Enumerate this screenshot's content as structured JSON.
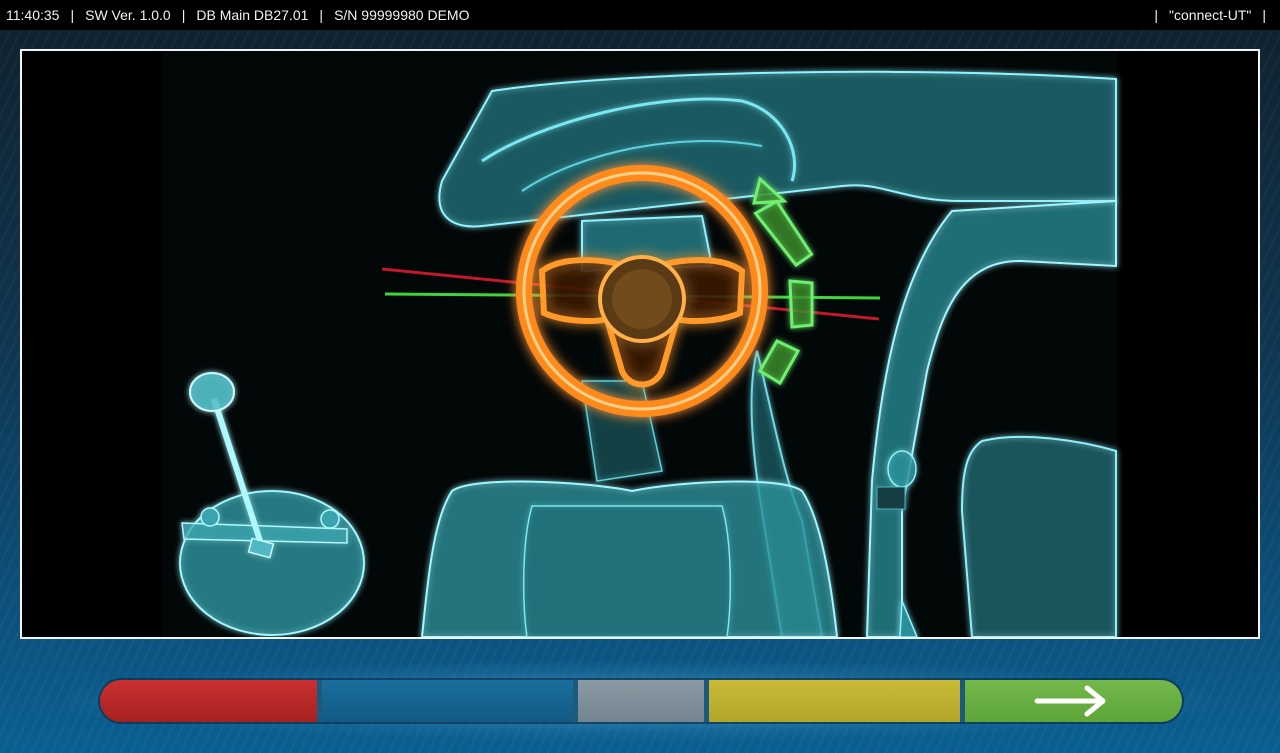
{
  "status_bar": {
    "time": "11:40:35",
    "software_version": "SW Ver. 1.0.0",
    "database": "DB Main DB27.01",
    "serial": "S/N 99999980 DEMO",
    "connection": "\"connect-UT\""
  },
  "viewer": {
    "image_subject": "steering-wheel-alignment-illustration",
    "indicator_colors": {
      "wheel": "#ff8a1a",
      "reference_line": "#3fd43f",
      "offset_line": "#c0192a",
      "rotation_arrow": "#5fe05f",
      "car_outline": "#5fe6f0"
    }
  },
  "function_keys": [
    {
      "id": "f1",
      "color": "#c02828"
    },
    {
      "id": "f2",
      "color": "#17668f"
    },
    {
      "id": "f3",
      "color": "#7f8f99"
    },
    {
      "id": "f4",
      "color": "#c2b432"
    },
    {
      "id": "f5",
      "color": "#6ab244",
      "icon": "arrow-right-icon"
    }
  ]
}
